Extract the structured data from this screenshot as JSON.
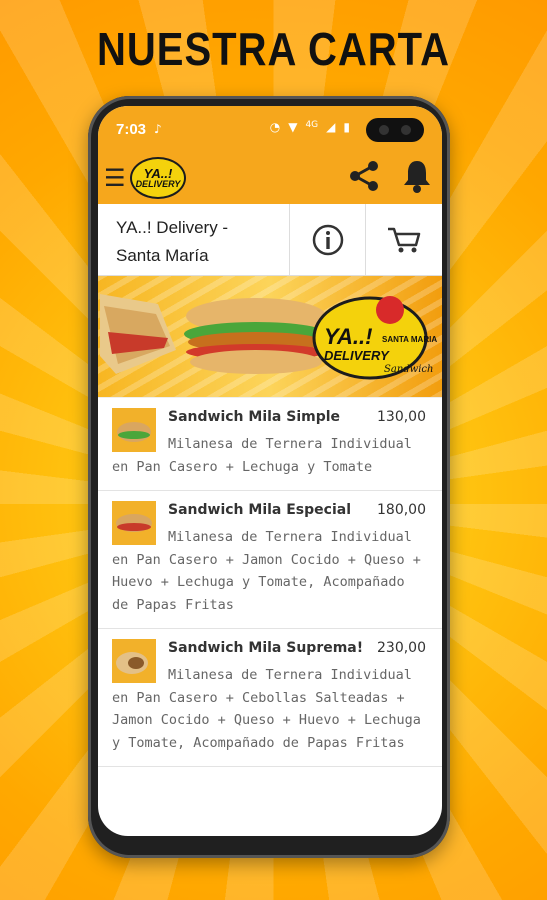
{
  "promo": {
    "title": "NUESTRA CARTA"
  },
  "status_bar": {
    "time": "7:03",
    "left_icon": "tiktok-icon",
    "network": "4G"
  },
  "app_bar": {
    "logo_text_top": "YA..!",
    "logo_text_bottom": "DELIVERY",
    "actions": [
      "share-icon",
      "bell-icon"
    ]
  },
  "shop": {
    "name_line1": "YA..! Delivery -",
    "name_line2": "Santa María",
    "info_icon": "info-icon",
    "cart_icon": "cart-icon"
  },
  "banner": {
    "brand_top": "YA..!",
    "brand_bottom": "DELIVERY",
    "location": "SANTA MARIA",
    "badge": "Sandwich"
  },
  "menu_items": [
    {
      "name": "Sandwich Mila Simple",
      "price": "130,00",
      "description": "Milanesa de Ternera Individual en Pan Casero + Lechuga y Tomate"
    },
    {
      "name": "Sandwich Mila Especial",
      "price": "180,00",
      "description": "Milanesa de Ternera Individual en Pan Casero + Jamon Cocido + Queso + Huevo + Lechuga y Tomate, Acompañado de Papas Fritas"
    },
    {
      "name": "Sandwich Mila Suprema!",
      "price": "230,00",
      "description": "Milanesa de Ternera Individual en Pan Casero + Cebollas Salteadas + Jamon Cocido + Queso + Huevo + Lechuga y Tomate, Acompañado de Papas Fritas"
    }
  ],
  "colors": {
    "accent": "#f6a71c",
    "background_orange": "#ffa800",
    "text_dark": "#333333"
  }
}
